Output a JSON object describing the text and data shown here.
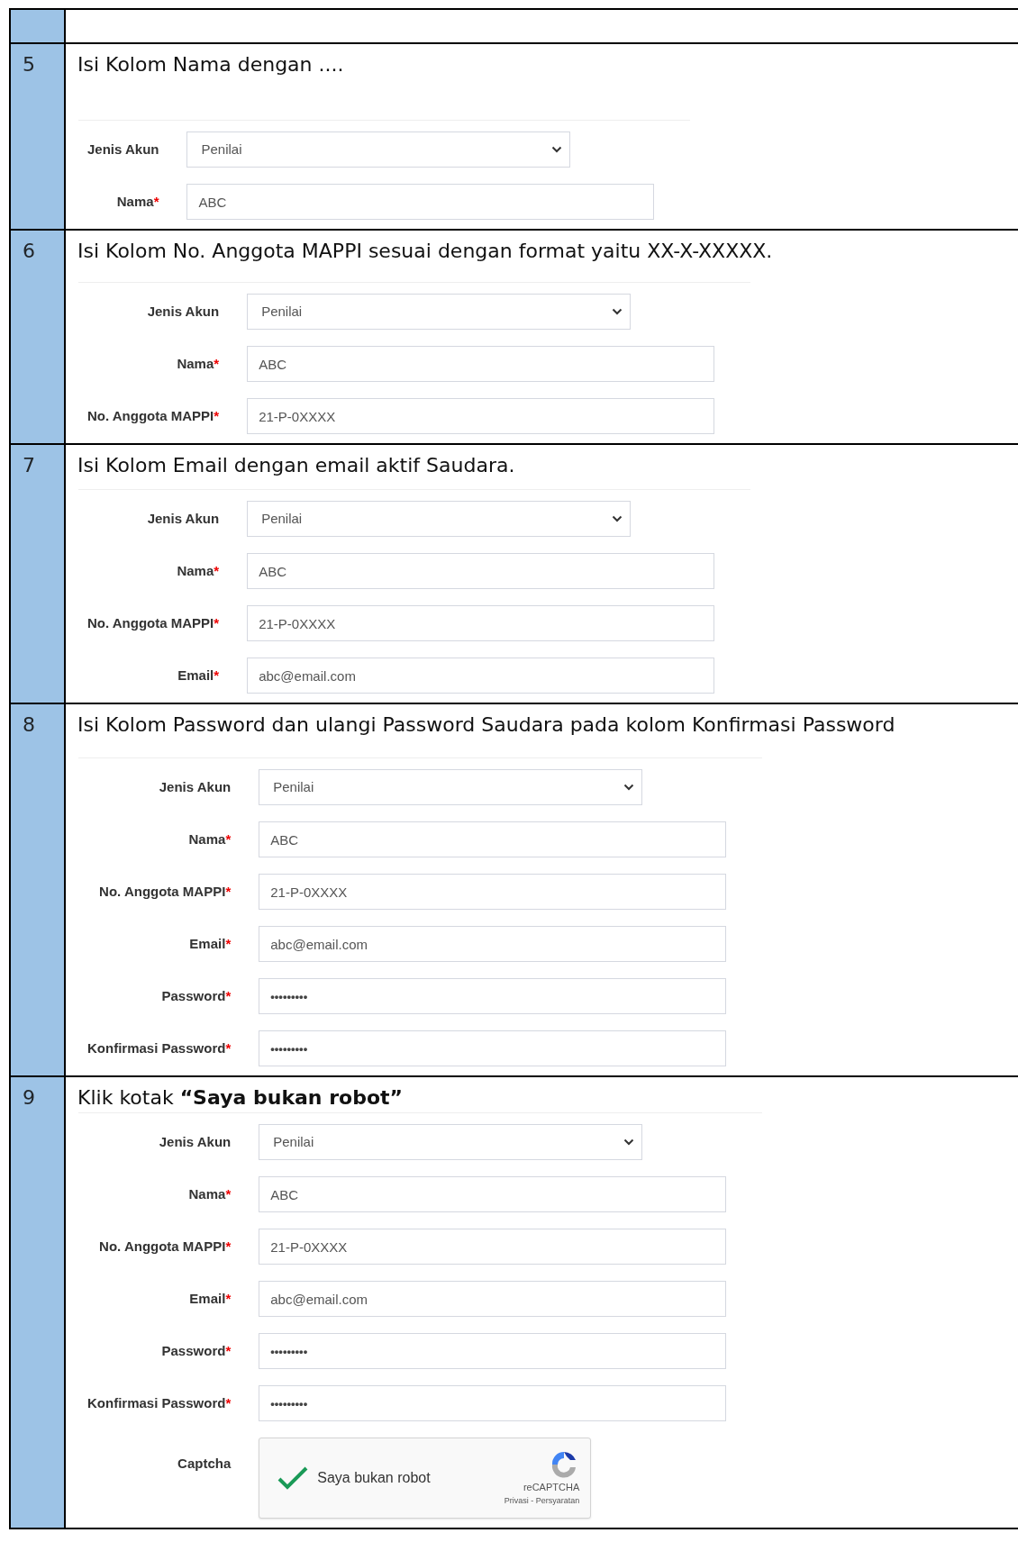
{
  "required_mark": "*",
  "steps": [
    {
      "number": "5",
      "instruction": "Isi Kolom Nama dengan ....",
      "fields": [
        {
          "kind": "select",
          "label": "Jenis Akun",
          "required": false,
          "value": "Penilai"
        },
        {
          "kind": "text",
          "label": "Nama",
          "required": true,
          "value": "ABC"
        }
      ]
    },
    {
      "number": "6",
      "instruction": "Isi Kolom No. Anggota MAPPI sesuai dengan format yaitu XX-X-XXXXX.",
      "fields": [
        {
          "kind": "select",
          "label": "Jenis Akun",
          "required": false,
          "value": "Penilai"
        },
        {
          "kind": "text",
          "label": "Nama",
          "required": true,
          "value": "ABC"
        },
        {
          "kind": "text",
          "label": "No. Anggota MAPPI",
          "required": true,
          "value": "21-P-0XXXX"
        }
      ]
    },
    {
      "number": "7",
      "instruction": "Isi Kolom Email dengan email aktif Saudara.",
      "fields": [
        {
          "kind": "select",
          "label": "Jenis Akun",
          "required": false,
          "value": "Penilai"
        },
        {
          "kind": "text",
          "label": "Nama",
          "required": true,
          "value": "ABC"
        },
        {
          "kind": "text",
          "label": "No. Anggota MAPPI",
          "required": true,
          "value": "21-P-0XXXX"
        },
        {
          "kind": "text",
          "label": "Email",
          "required": true,
          "value": "abc@email.com"
        }
      ]
    },
    {
      "number": "8",
      "instruction": "Isi Kolom Password dan ulangi Password Saudara pada kolom Konfirmasi Password",
      "fields": [
        {
          "kind": "select",
          "label": "Jenis Akun",
          "required": false,
          "value": "Penilai"
        },
        {
          "kind": "text",
          "label": "Nama",
          "required": true,
          "value": "ABC"
        },
        {
          "kind": "text",
          "label": "No. Anggota MAPPI",
          "required": true,
          "value": "21-P-0XXXX"
        },
        {
          "kind": "text",
          "label": "Email",
          "required": true,
          "value": "abc@email.com"
        },
        {
          "kind": "password",
          "label": "Password",
          "required": true,
          "value": "•••••••••"
        },
        {
          "kind": "password",
          "label": "Konfirmasi Password",
          "required": true,
          "value": "•••••••••"
        }
      ]
    },
    {
      "number": "9",
      "instruction": "Klik kotak **“Saya bukan robot”**",
      "fields": [
        {
          "kind": "select",
          "label": "Jenis Akun",
          "required": false,
          "value": "Penilai"
        },
        {
          "kind": "text",
          "label": "Nama",
          "required": true,
          "value": "ABC"
        },
        {
          "kind": "text",
          "label": "No. Anggota MAPPI",
          "required": true,
          "value": "21-P-0XXXX"
        },
        {
          "kind": "text",
          "label": "Email",
          "required": true,
          "value": "abc@email.com"
        },
        {
          "kind": "password",
          "label": "Password",
          "required": true,
          "value": "•••••••••"
        },
        {
          "kind": "password",
          "label": "Konfirmasi Password",
          "required": true,
          "value": "•••••••••"
        },
        {
          "kind": "captcha",
          "label": "Captcha",
          "required": false,
          "checked": true,
          "text": "Saya bukan robot",
          "brand": "reCAPTCHA",
          "links": "Privasi - Persyaratan"
        }
      ]
    }
  ]
}
